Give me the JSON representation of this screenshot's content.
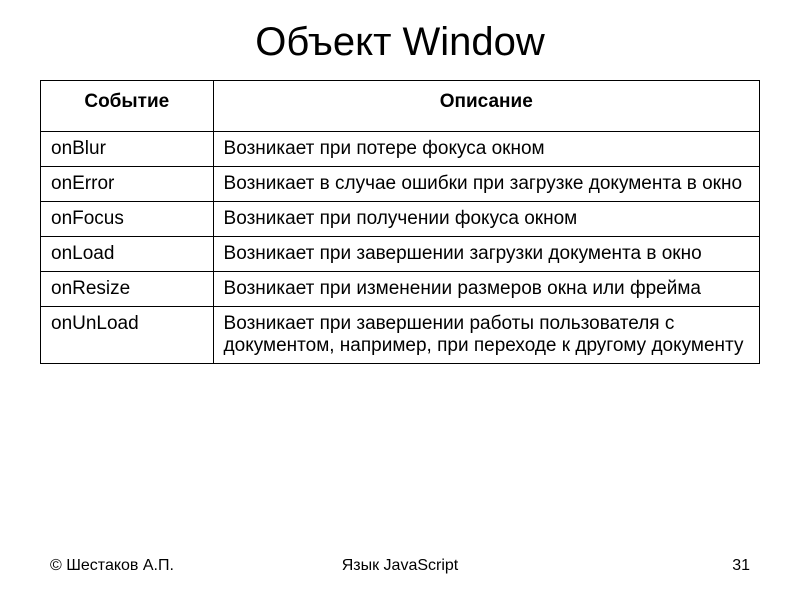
{
  "title": "Объект Window",
  "headers": {
    "event": "Событие",
    "description": "Описание"
  },
  "rows": [
    {
      "event": "onBlur",
      "description": "Возникает при потере фокуса окном"
    },
    {
      "event": "onError",
      "description": "Возникает в случае ошибки при загрузке документа в окно"
    },
    {
      "event": "onFocus",
      "description": "Возникает при получении фокуса окном"
    },
    {
      "event": "onLoad",
      "description": "Возникает при завершении загрузки документа в окно"
    },
    {
      "event": "onResize",
      "description": "Возникает при изменении размеров окна или фрейма"
    },
    {
      "event": "onUnLoad",
      "description": "Возникает при завершении работы пользователя с документом, например, при переходе к другому документу"
    }
  ],
  "footer": {
    "author": "© Шестаков А.П.",
    "subject": "Язык JavaScript",
    "page": "31"
  }
}
